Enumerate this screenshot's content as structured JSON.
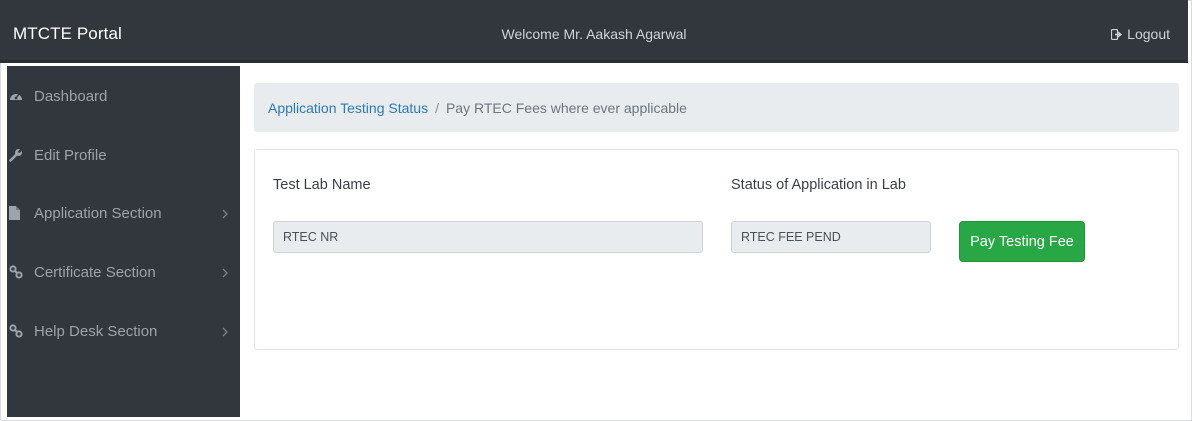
{
  "header": {
    "brand": "MTCTE Portal",
    "welcome": "Welcome Mr. Aakash Agarwal",
    "logout_label": "Logout",
    "logout_icon": "sign-out-icon"
  },
  "sidebar": {
    "items": [
      {
        "label": "Dashboard",
        "icon": "tachometer-icon",
        "has_submenu": false
      },
      {
        "label": "Edit Profile",
        "icon": "wrench-icon",
        "has_submenu": false
      },
      {
        "label": "Application Section",
        "icon": "file-icon",
        "has_submenu": true
      },
      {
        "label": "Certificate Section",
        "icon": "link-icon",
        "has_submenu": true
      },
      {
        "label": "Help Desk Section",
        "icon": "link-icon",
        "has_submenu": true
      }
    ]
  },
  "breadcrumb": {
    "link": "Application Testing Status",
    "separator": "/",
    "current": "Pay RTEC Fees where ever applicable"
  },
  "form": {
    "lab_label": "Test Lab Name",
    "lab_value": "RTEC NR",
    "status_label": "Status of Application in Lab",
    "status_value": "RTEC FEE PEND",
    "pay_button": "Pay Testing Fee"
  },
  "colors": {
    "nav_bg": "#32363d",
    "link": "#2a7ab8",
    "button_green": "#28a745",
    "breadcrumb_bg": "#e9ecef"
  }
}
